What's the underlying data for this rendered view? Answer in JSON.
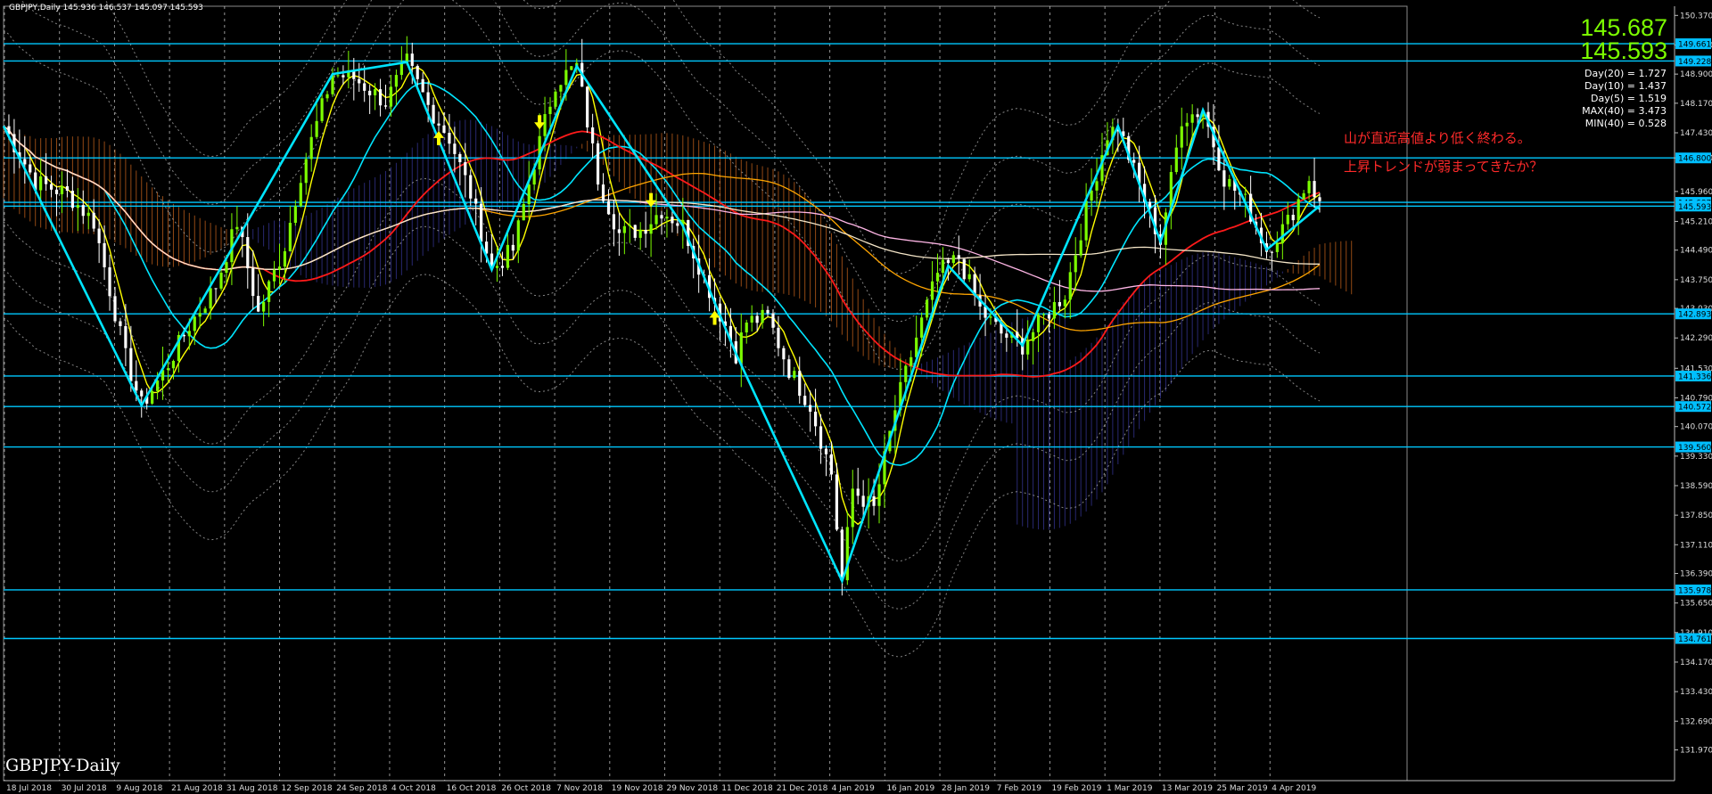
{
  "header": {
    "symbol_line": "GBPJPY,Daily  145.936 146.537 145.097 145.593",
    "footer_label": "GBPJPY-Daily"
  },
  "quote": {
    "ask": "145.687",
    "bid": "145.593"
  },
  "indicator_stats": [
    "Day(20) = 1.727",
    "Day(10) = 1.437",
    "Day(5) = 1.519",
    "MAX(40) = 3.473",
    "MIN(40) = 0.528"
  ],
  "annotations": [
    "山が直近高値より低く終わる。",
    "上昇トレンドが弱まってきたか？"
  ],
  "colors": {
    "background": "#000000",
    "grid": "#c8c8c8",
    "bull_candle": "#7CFC00",
    "bear_candle": "#ffffff",
    "hline": "#00c8ff",
    "ma_fast": "#ffff00",
    "ma_mid": "#00e5ff",
    "ma_slow": "#ff1a1a",
    "ma_200": "#f5e6c8",
    "ma_long": "#ffa500",
    "ma_longest": "#ffb6e6",
    "cloud_bull": "#3a3aa0",
    "cloud_bear": "#d2691e",
    "arrow": "#ffff00",
    "price_text": "#7CFC00",
    "note_text": "#ff2a2a",
    "zigzag": "#00e5ff"
  },
  "chart_data": {
    "type": "candlestick",
    "instrument": "GBPJPY",
    "timeframe": "Daily",
    "ylim": [
      131.2,
      150.6
    ],
    "y_ticks": [
      "150.370",
      "149.630",
      "148.900",
      "148.170",
      "147.430",
      "146.800",
      "145.960",
      "145.210",
      "144.490",
      "143.750",
      "143.030",
      "142.290",
      "141.530",
      "140.790",
      "140.070",
      "139.330",
      "138.590",
      "137.850",
      "137.110",
      "136.390",
      "135.650",
      "134.910",
      "134.170",
      "133.430",
      "132.690",
      "131.970"
    ],
    "x_labels": [
      "18 Jul 2018",
      "30 Jul 2018",
      "9 Aug 2018",
      "21 Aug 2018",
      "31 Aug 2018",
      "12 Sep 2018",
      "24 Sep 2018",
      "4 Oct 2018",
      "16 Oct 2018",
      "26 Oct 2018",
      "7 Nov 2018",
      "19 Nov 2018",
      "29 Nov 2018",
      "11 Dec 2018",
      "21 Dec 2018",
      "4 Jan 2019",
      "16 Jan 2019",
      "28 Jan 2019",
      "7 Feb 2019",
      "19 Feb 2019",
      "1 Mar 2019",
      "13 Mar 2019",
      "25 Mar 2019",
      "4 Apr 2019"
    ],
    "hlines": [
      {
        "label": "149.661",
        "value": 149.661
      },
      {
        "label": "149.228",
        "value": 149.228
      },
      {
        "label": "146.800",
        "value": 146.8
      },
      {
        "label": "145.687",
        "value": 145.687
      },
      {
        "label": "145.593",
        "value": 145.593
      },
      {
        "label": "142.893",
        "value": 142.893
      },
      {
        "label": "141.336",
        "value": 141.336
      },
      {
        "label": "140.572",
        "value": 140.572
      },
      {
        "label": "139.560",
        "value": 139.56
      },
      {
        "label": "135.978",
        "value": 135.978
      },
      {
        "label": "134.761",
        "value": 134.761
      }
    ],
    "close_path": [
      [
        0,
        147.6
      ],
      [
        6,
        146.2
      ],
      [
        12,
        145.9
      ],
      [
        17,
        145.2
      ],
      [
        23,
        141.8
      ],
      [
        26,
        140.6
      ],
      [
        30,
        141.4
      ],
      [
        35,
        142.6
      ],
      [
        40,
        143.6
      ],
      [
        44,
        145.2
      ],
      [
        48,
        142.9
      ],
      [
        53,
        144.6
      ],
      [
        56,
        146.4
      ],
      [
        62,
        148.9
      ],
      [
        66,
        148.8
      ],
      [
        72,
        148.2
      ],
      [
        76,
        149.2
      ],
      [
        80,
        148.1
      ],
      [
        84,
        147.3
      ],
      [
        88,
        145.9
      ],
      [
        92,
        144.0
      ],
      [
        96,
        144.5
      ],
      [
        100,
        146.7
      ],
      [
        104,
        148.7
      ],
      [
        108,
        149.1
      ],
      [
        112,
        146.3
      ],
      [
        116,
        144.9
      ],
      [
        120,
        145.0
      ],
      [
        124,
        145.5
      ],
      [
        128,
        145.1
      ],
      [
        132,
        143.8
      ],
      [
        136,
        142.6
      ],
      [
        138,
        141.9
      ],
      [
        140,
        142.7
      ],
      [
        144,
        142.8
      ],
      [
        148,
        141.5
      ],
      [
        152,
        140.6
      ],
      [
        156,
        138.9
      ],
      [
        158,
        136.2
      ],
      [
        160,
        138.5
      ],
      [
        164,
        138.0
      ],
      [
        168,
        140.5
      ],
      [
        172,
        142.3
      ],
      [
        176,
        143.9
      ],
      [
        180,
        144.3
      ],
      [
        184,
        143.0
      ],
      [
        188,
        142.4
      ],
      [
        192,
        142.1
      ],
      [
        196,
        142.8
      ],
      [
        200,
        143.4
      ],
      [
        204,
        145.5
      ],
      [
        208,
        147.4
      ],
      [
        210,
        147.6
      ],
      [
        214,
        146.1
      ],
      [
        218,
        144.7
      ],
      [
        222,
        147.8
      ],
      [
        226,
        148.0
      ],
      [
        230,
        146.3
      ],
      [
        234,
        145.7
      ],
      [
        238,
        144.5
      ],
      [
        242,
        145.2
      ],
      [
        246,
        146.3
      ],
      [
        248,
        145.6
      ]
    ],
    "horizon": 248
  }
}
